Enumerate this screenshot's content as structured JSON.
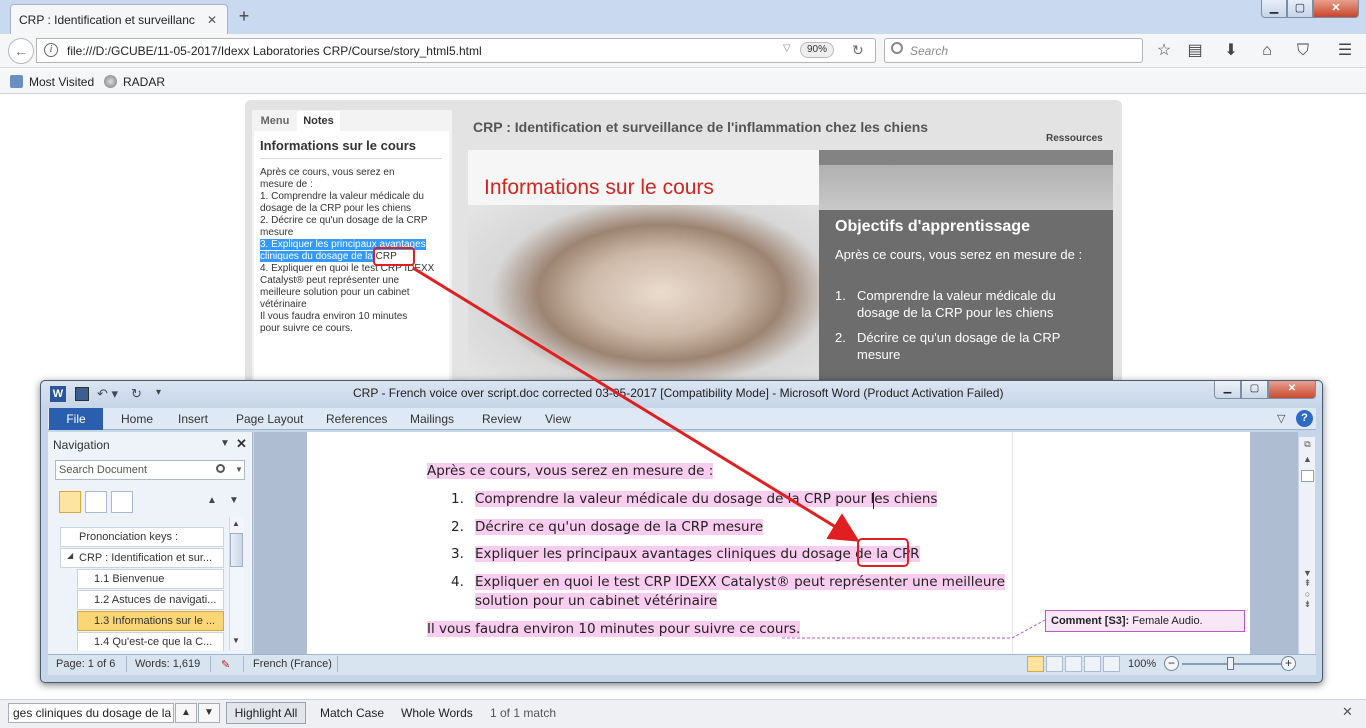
{
  "browser": {
    "tab_title": "CRP : Identification et surveillanc",
    "tab_close": "✕",
    "new_tab": "+",
    "window_min": "▁",
    "window_max": "▢",
    "window_close": "✕",
    "url": "file:///D:/GCUBE/11-05-2017/Idexx Laboratories CRP/Course/story_html5.html",
    "zoom": "90%",
    "search_placeholder": "Search",
    "bookmarks": [
      "Most Visited",
      "RADAR"
    ]
  },
  "player": {
    "tabs": [
      "Menu",
      "Notes"
    ],
    "notes_title": "Informations sur le cours",
    "notes_lines": [
      "Après ce cours, vous serez en",
      "mesure de :",
      "1. Comprendre la valeur médicale du",
      "dosage de la CRP pour les chiens",
      "2. Décrire ce qu'un dosage de la CRP",
      "mesure"
    ],
    "notes_highlight_1": "3. Expliquer les principaux avantages",
    "notes_highlight_2": "cliniques du dosage de la",
    "notes_crp": "CRP",
    "notes_lines_after": [
      "4. Expliquer en quoi le test CRP IDEXX",
      "Catalyst® peut représenter une",
      "meilleure solution pour un cabinet",
      "vétérinaire",
      "Il vous faudra environ 10 minutes",
      "pour suivre ce cours."
    ],
    "course_title": "CRP : Identification et surveillance de l'inflammation chez les chiens",
    "resources": "Ressources",
    "slide_heading": "Informations sur le cours",
    "slide_objectives": "Objectifs d'apprentissage",
    "slide_intro": "Après ce cours, vous serez en mesure de :",
    "slide_items": [
      {
        "num": "1.",
        "text": "Comprendre la valeur médicale du dosage de la CRP pour les chiens"
      },
      {
        "num": "2.",
        "text": "Décrire ce qu'un dosage de la CRP mesure"
      }
    ]
  },
  "word": {
    "title": "CRP - French voice over script.doc corrected 03-05-2017 [Compatibility Mode]  -  Microsoft Word (Product Activation Failed)",
    "file_tab": "File",
    "ribbon_tabs": [
      "Home",
      "Insert",
      "Page Layout",
      "References",
      "Mailings",
      "Review",
      "View"
    ],
    "nav": {
      "title": "Navigation",
      "search_placeholder": "Search Document",
      "items": [
        "Prononciation keys :",
        "CRP : Identification et sur...",
        "1.1 Bienvenue",
        "1.2 Astuces de navigati...",
        "1.3 Informations sur le ...",
        "1.4 Qu'est-ce que la C..."
      ]
    },
    "doc": {
      "intro": "Après ce cours, vous serez en mesure de :",
      "items": [
        {
          "num": "1.",
          "text": "Comprendre la valeur médicale du dosage de la CRP pour les chiens"
        },
        {
          "num": "2.",
          "text": "Décrire ce qu'un dosage de la CRP mesure"
        },
        {
          "num": "3.",
          "text": "Expliquer les principaux avantages cliniques du dosage de la CPR"
        },
        {
          "num": "4.",
          "text": "Expliquer en quoi le test CRP IDEXX Catalyst® peut représenter une meilleure"
        }
      ],
      "item4_line2": "solution pour un cabinet vétérinaire",
      "closing": "Il vous faudra environ 10 minutes pour suivre ce cours."
    },
    "comment_label": "Comment [S3]:",
    "comment_text": "Female Audio.",
    "status": {
      "page": "Page: 1 of 6",
      "words": "Words: 1,619",
      "language": "French (France)",
      "zoom": "100%",
      "zoom_level_percent": 100
    }
  },
  "findbar": {
    "query": "ges cliniques du dosage de la",
    "highlight_all": "Highlight All",
    "match_case": "Match Case",
    "whole_words": "Whole Words",
    "status": "1 of 1 match"
  },
  "colors": {
    "highlight_pink": "#f9cdef",
    "annotation_red": "#e02020",
    "selection_blue": "#3399ff",
    "word_file_tab": "#2a5fb0"
  }
}
